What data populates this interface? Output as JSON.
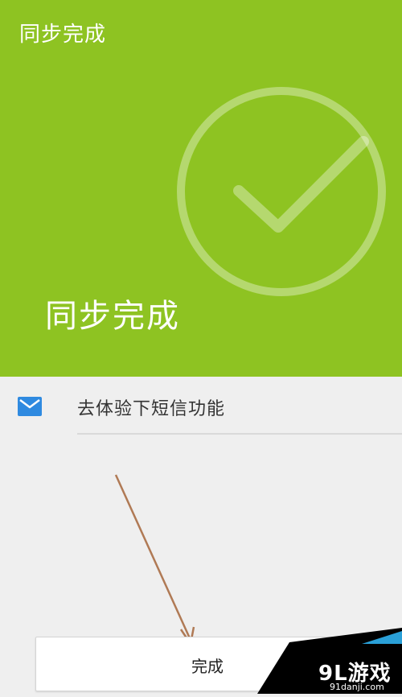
{
  "header": {
    "app_title": "同步完成",
    "big_title": "同步完成",
    "bg_color": "#8ec322",
    "graphic_icon": "check-circle-icon"
  },
  "list": {
    "items": [
      {
        "icon": "mail-icon",
        "label": "去体验下短信功能"
      }
    ]
  },
  "annotation": {
    "arrow_color": "#b07a55",
    "icon": "arrow-annotation"
  },
  "footer": {
    "done_label": "完成"
  },
  "watermark": {
    "brand": "9L游戏",
    "url": "91danji.com"
  }
}
